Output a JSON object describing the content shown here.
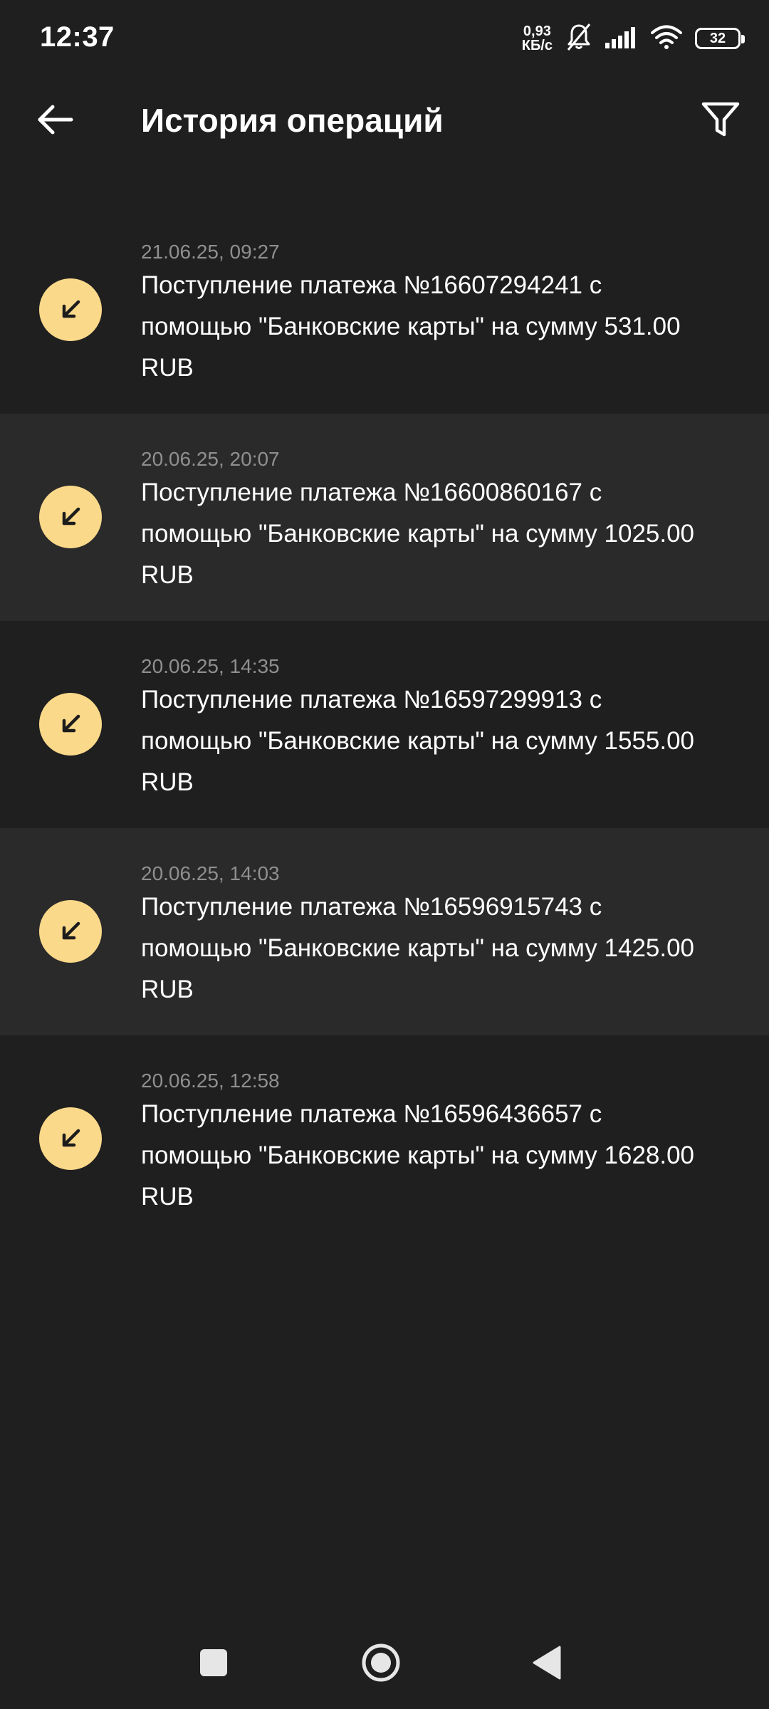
{
  "status_bar": {
    "time": "12:37",
    "net_speed_value": "0,93",
    "net_speed_unit": "КБ/с",
    "battery": "32"
  },
  "header": {
    "title": "История операций"
  },
  "operations": [
    {
      "date": "21.06.25, 09:27",
      "description": "Поступление платежа №16607294241 с помощью \"Банковские карты\" на сумму 531.00 RUB"
    },
    {
      "date": "20.06.25, 20:07",
      "description": "Поступление платежа №16600860167 с помощью \"Банковские карты\" на сумму 1025.00 RUB"
    },
    {
      "date": "20.06.25, 14:35",
      "description": "Поступление платежа №16597299913 с помощью \"Банковские карты\" на сумму 1555.00 RUB"
    },
    {
      "date": "20.06.25, 14:03",
      "description": "Поступление платежа №16596915743 с помощью \"Банковские карты\" на сумму 1425.00 RUB"
    },
    {
      "date": "20.06.25, 12:58",
      "description": "Поступление платежа №16596436657 с помощью \"Банковские карты\" на сумму 1628.00 RUB"
    }
  ],
  "icons": {
    "back": "arrow-left-icon",
    "filter": "filter-icon",
    "incoming": "arrow-down-left-icon",
    "nav_recents": "square-icon",
    "nav_home": "circle-icon",
    "nav_back": "triangle-icon"
  },
  "colors": {
    "background": "#1f1f1f",
    "row_alt_background": "#2a2a2a",
    "accent": "#fbd98a",
    "date_text": "#8f8f8f"
  }
}
